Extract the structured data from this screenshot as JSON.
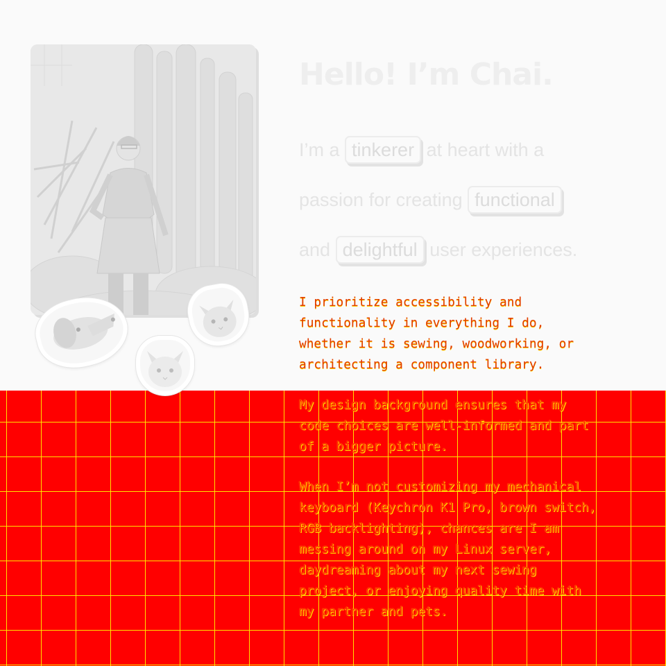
{
  "about": {
    "heading": "Hello! I’m Chai.",
    "tagline": {
      "line1_pre": "I’m a",
      "pill1": "tinkerer",
      "line1_post": "at heart with a",
      "line2_pre": "passion for creating",
      "pill2": "functional",
      "line3_pre": "and",
      "pill3": "delightful",
      "line3_post": "user experiences."
    },
    "paragraph1": "I prioritize accessibility and\nfunctionality in everything I do,\nwhether it is sewing, woodworking, or\narchitecting a component library.",
    "paragraph2": "My design background ensures that my\ncode choices are well-informed and part\nof a bigger picture.",
    "paragraph3": "When I’m not customizing my mechanical\nkeyboard (Keychron K1 Pro, brown switch,\nRGB backlighting), chances are I am\nmessing around on my Linux server,\ndaydreaming about my next sewing\nproject, or enjoying quality time with\nmy partner and pets."
  },
  "images": {
    "portrait": "portrait-photo",
    "pets": [
      "dog-sticker",
      "cat-sticker",
      "cat-sticker"
    ]
  },
  "colors": {
    "background": "#fafafa",
    "overlay_red": "#ff0000",
    "grid_yellow": "#ffee00",
    "mono_text": "#ff2a00"
  }
}
